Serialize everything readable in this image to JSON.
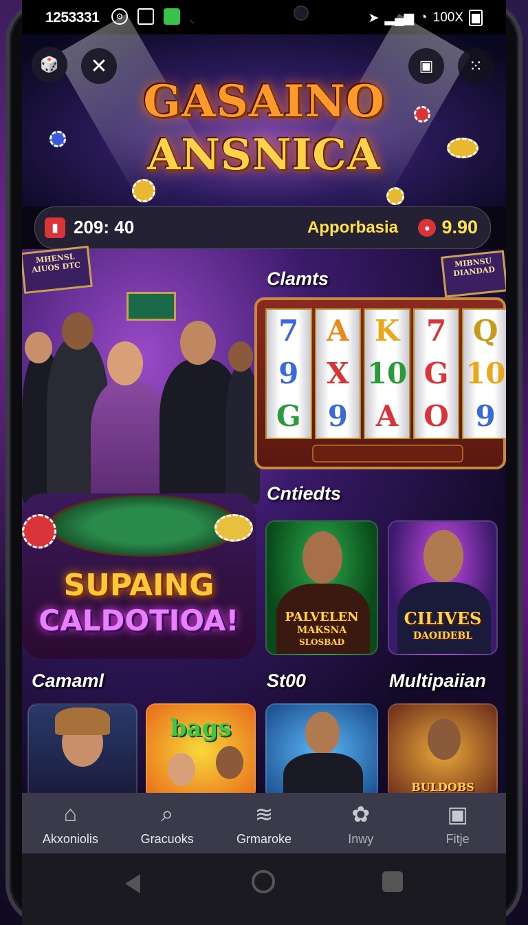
{
  "status_bar": {
    "time": "1253331",
    "battery": "100X"
  },
  "hero": {
    "logo_line1": "GASAINO",
    "logo_line2": "ANSNICA"
  },
  "balance_bar": {
    "left_value": "209: 40",
    "label": "Apporbasia",
    "right_value": "9.90"
  },
  "sections": {
    "slots_title": "Clamts",
    "featured_title": "Cntiedts",
    "promo_line1": "SUPAING",
    "promo_line2": "CALDOTIOA!",
    "row_titles": [
      "Camaml",
      "St00",
      "Multipaiian"
    ]
  },
  "slot_machine": {
    "reels": [
      [
        "7",
        "9",
        "G"
      ],
      [
        "A",
        "X",
        "9"
      ],
      [
        "K",
        "10",
        "A"
      ],
      [
        "7",
        "G",
        "O"
      ],
      [
        "Q",
        "10",
        "9"
      ]
    ]
  },
  "featured_cards": [
    {
      "label_line1": "PALVELEN",
      "label_line2": "MAKSNA",
      "label_line3": "SLOSBAD"
    },
    {
      "label_line1": "CILIVES",
      "label_line2": "DAOIDEBL"
    }
  ],
  "row_cards": [
    {
      "label": ""
    },
    {
      "label": "bags"
    },
    {
      "label": ""
    },
    {
      "label": "BULDOBS"
    }
  ],
  "signs": {
    "left": "MHENSL AIUOS DTC",
    "mid": "",
    "right": "MIBNSU DIANDAD"
  },
  "bottom_nav": [
    {
      "label": "Akxoniolis",
      "icon": "home-icon"
    },
    {
      "label": "Gracuoks",
      "icon": "search-icon"
    },
    {
      "label": "Grmaroke",
      "icon": "layers-icon"
    },
    {
      "label": "Inwy",
      "icon": "cluster-icon"
    },
    {
      "label": "Fitje",
      "icon": "profile-icon"
    }
  ],
  "colors": {
    "gold": "#ffd24a",
    "accent_red": "#d8343a",
    "nav_bg": "#3a3a4a"
  }
}
